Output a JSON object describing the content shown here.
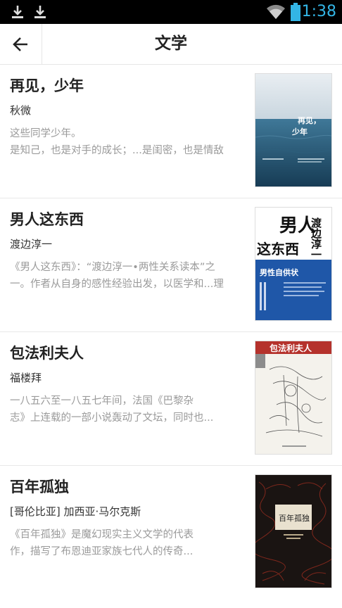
{
  "status": {
    "time": "1:38",
    "accent": "#33b5e5"
  },
  "header": {
    "title": "文学",
    "back_icon": "arrow-left-icon"
  },
  "books": [
    {
      "title": "再见，少年",
      "author": "秋微",
      "desc_lines": [
        "这些同学少年。",
        "是知己，也是对手的成长；...是闺密，也是情敌"
      ]
    },
    {
      "title": "男人这东西",
      "author": "渡边淳一",
      "desc_lines": [
        "《男人这东西》：“渡边淳一•两性关系读本”之",
        "一。作者从自身的感性经验出发，以医学和...理"
      ]
    },
    {
      "title": "包法利夫人",
      "author": "福楼拜",
      "desc_lines": [
        "一八五六至一八五七年间，法国《巴黎杂",
        "志》上连载的一部小说轰动了文坛，同时也..."
      ]
    },
    {
      "title": "百年孤独",
      "author": "[哥伦比亚] 加西亚·马尔克斯",
      "desc_lines": [
        "《百年孤独》是魔幻现实主义文学的代表",
        "作，描写了布恩迪亚家族七代人的传奇..."
      ]
    }
  ],
  "covers": {
    "c1": {
      "line1": "再见，",
      "line2": "少年"
    },
    "c2": {
      "big1": "男人",
      "big2": "这东西",
      "author": "渡边淳一",
      "tag": "男性自供状"
    },
    "c3": {
      "title": "包法利夫人"
    },
    "c4": {
      "title": "百年孤独"
    }
  }
}
